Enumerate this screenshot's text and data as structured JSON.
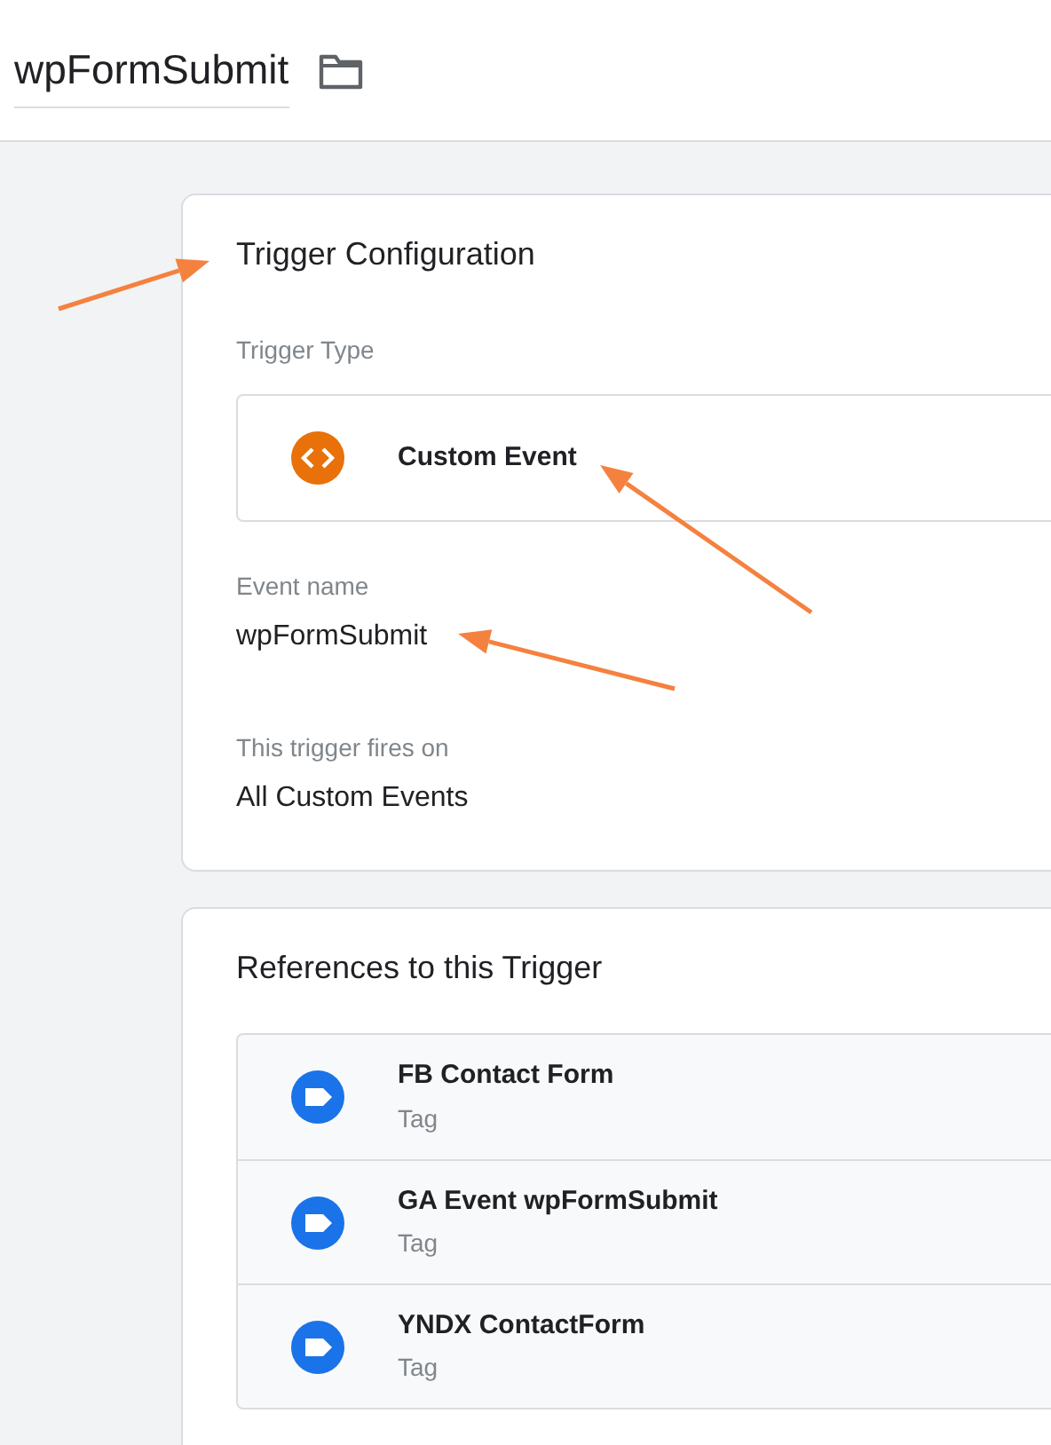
{
  "header": {
    "title": "wpFormSubmit"
  },
  "trigger_configuration": {
    "title": "Trigger Configuration",
    "type_label": "Trigger Type",
    "type_value": "Custom Event",
    "fields": [
      {
        "label": "Event name",
        "value": "wpFormSubmit"
      },
      {
        "label": "This trigger fires on",
        "value": "All Custom Events"
      }
    ]
  },
  "references": {
    "title": "References to this Trigger",
    "items": [
      {
        "name": "FB Contact Form",
        "type": "Tag"
      },
      {
        "name": "GA Event wpFormSubmit",
        "type": "Tag"
      },
      {
        "name": "YNDX ContactForm",
        "type": "Tag"
      }
    ]
  }
}
